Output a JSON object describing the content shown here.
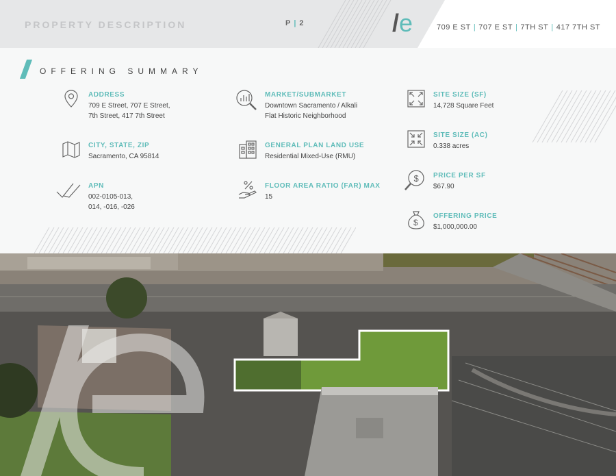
{
  "header": {
    "title": "PROPERTY DESCRIPTION",
    "page_prefix": "P",
    "page_number": "2",
    "logo_text": "e",
    "addresses": [
      "709 E ST",
      "707 E ST",
      "7TH ST",
      "417 7TH ST"
    ]
  },
  "summary": {
    "title": "OFFERING SUMMARY",
    "col1": [
      {
        "label": "ADDRESS",
        "lines": [
          "709 E Street, 707 E Street,",
          "7th Street, 417 7th Street"
        ]
      },
      {
        "label": "CITY, STATE, ZIP",
        "lines": [
          "Sacramento, CA 95814"
        ]
      },
      {
        "label": "APN",
        "lines": [
          "002-0105-013,",
          "014, -016, -026"
        ]
      }
    ],
    "col2": [
      {
        "label": "MARKET/SUBMARKET",
        "lines": [
          "Downtown Sacramento / Alkali",
          "Flat Historic Neighborhood"
        ]
      },
      {
        "label": "GENERAL PLAN LAND USE",
        "lines": [
          "Residential Mixed-Use (RMU)"
        ]
      },
      {
        "label": "FLOOR AREA RATIO (FAR) MAX",
        "lines": [
          "15"
        ]
      }
    ],
    "col3": [
      {
        "label": "SITE SIZE (SF)",
        "lines": [
          "14,728 Square Feet"
        ]
      },
      {
        "label": "SITE SIZE (AC)",
        "lines": [
          "0.338 acres"
        ]
      },
      {
        "label": "PRICE PER SF",
        "lines": [
          "$67.90"
        ]
      },
      {
        "label": "OFFERING PRICE",
        "lines": [
          "$1,000,000.00"
        ]
      }
    ],
    "icons": [
      "location-pin-icon",
      "magnifier-chart-icon",
      "expand-arrows-icon",
      "map-icon",
      "building-icon",
      "collapse-arrows-icon",
      "checkmark-icon",
      "percent-hand-icon",
      "price-magnifier-icon",
      "money-bag-icon"
    ]
  },
  "colors": {
    "accent": "#5fbcb9",
    "header_bg": "#e6e7e8",
    "summary_bg": "#f7f8f8",
    "text": "#444444"
  }
}
